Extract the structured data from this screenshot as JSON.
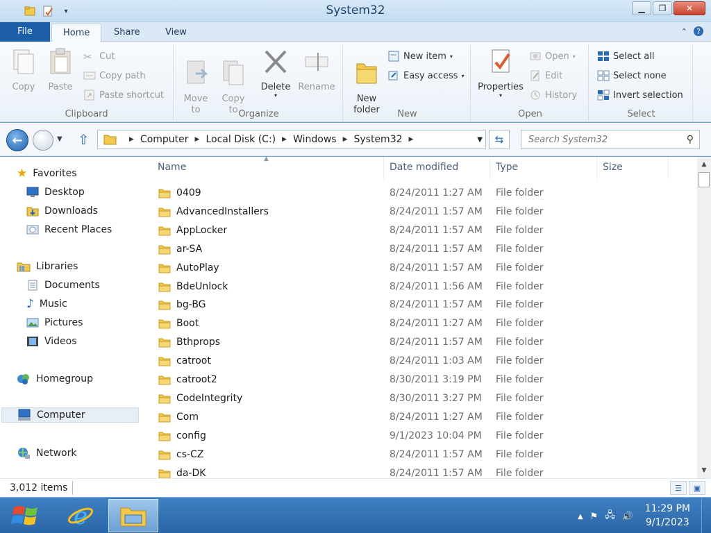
{
  "window": {
    "title": "System32",
    "controls": {
      "minimize": "▁",
      "restore": "❐",
      "close": "✕"
    }
  },
  "ribbon_tabs": [
    "File",
    "Home",
    "Share",
    "View"
  ],
  "ribbon": {
    "clipboard": {
      "label": "Clipboard",
      "copy": "Copy",
      "paste": "Paste",
      "cut": "Cut",
      "copy_path": "Copy path",
      "paste_shortcut": "Paste shortcut"
    },
    "organize": {
      "label": "Organize",
      "move_to": "Move\nto",
      "copy_to": "Copy\nto",
      "delete": "Delete",
      "rename": "Rename"
    },
    "new": {
      "label": "New",
      "new_folder": "New\nfolder",
      "new_item": "New item",
      "easy_access": "Easy access"
    },
    "open": {
      "label": "Open",
      "properties": "Properties",
      "open": "Open",
      "edit": "Edit",
      "history": "History"
    },
    "select": {
      "label": "Select",
      "select_all": "Select all",
      "select_none": "Select none",
      "invert_selection": "Invert selection"
    }
  },
  "address": {
    "segments": [
      "Computer",
      "Local Disk (C:)",
      "Windows",
      "System32"
    ],
    "search_placeholder": "Search System32"
  },
  "nav_pane": {
    "favorites": "Favorites",
    "favorites_items": [
      "Desktop",
      "Downloads",
      "Recent Places"
    ],
    "libraries": "Libraries",
    "libraries_items": [
      "Documents",
      "Music",
      "Pictures",
      "Videos"
    ],
    "homegroup": "Homegroup",
    "computer": "Computer",
    "network": "Network"
  },
  "columns": [
    "Name",
    "Date modified",
    "Type",
    "Size"
  ],
  "files": [
    {
      "name": "0409",
      "date": "8/24/2011 1:27 AM",
      "type": "File folder"
    },
    {
      "name": "AdvancedInstallers",
      "date": "8/24/2011 1:57 AM",
      "type": "File folder"
    },
    {
      "name": "AppLocker",
      "date": "8/24/2011 1:57 AM",
      "type": "File folder"
    },
    {
      "name": "ar-SA",
      "date": "8/24/2011 1:57 AM",
      "type": "File folder"
    },
    {
      "name": "AutoPlay",
      "date": "8/24/2011 1:57 AM",
      "type": "File folder"
    },
    {
      "name": "BdeUnlock",
      "date": "8/24/2011 1:56 AM",
      "type": "File folder"
    },
    {
      "name": "bg-BG",
      "date": "8/24/2011 1:57 AM",
      "type": "File folder"
    },
    {
      "name": "Boot",
      "date": "8/24/2011 1:27 AM",
      "type": "File folder"
    },
    {
      "name": "Bthprops",
      "date": "8/24/2011 1:57 AM",
      "type": "File folder"
    },
    {
      "name": "catroot",
      "date": "8/24/2011 1:03 AM",
      "type": "File folder"
    },
    {
      "name": "catroot2",
      "date": "8/30/2011 3:19 PM",
      "type": "File folder"
    },
    {
      "name": "CodeIntegrity",
      "date": "8/30/2011 3:27 PM",
      "type": "File folder"
    },
    {
      "name": "Com",
      "date": "8/24/2011 1:27 AM",
      "type": "File folder"
    },
    {
      "name": "config",
      "date": "9/1/2023 10:04 PM",
      "type": "File folder"
    },
    {
      "name": "cs-CZ",
      "date": "8/24/2011 1:57 AM",
      "type": "File folder"
    },
    {
      "name": "da-DK",
      "date": "8/24/2011 1:57 AM",
      "type": "File folder"
    }
  ],
  "status": {
    "item_count": "3,012 items"
  },
  "taskbar": {
    "time": "11:29 PM",
    "date": "9/1/2023"
  }
}
